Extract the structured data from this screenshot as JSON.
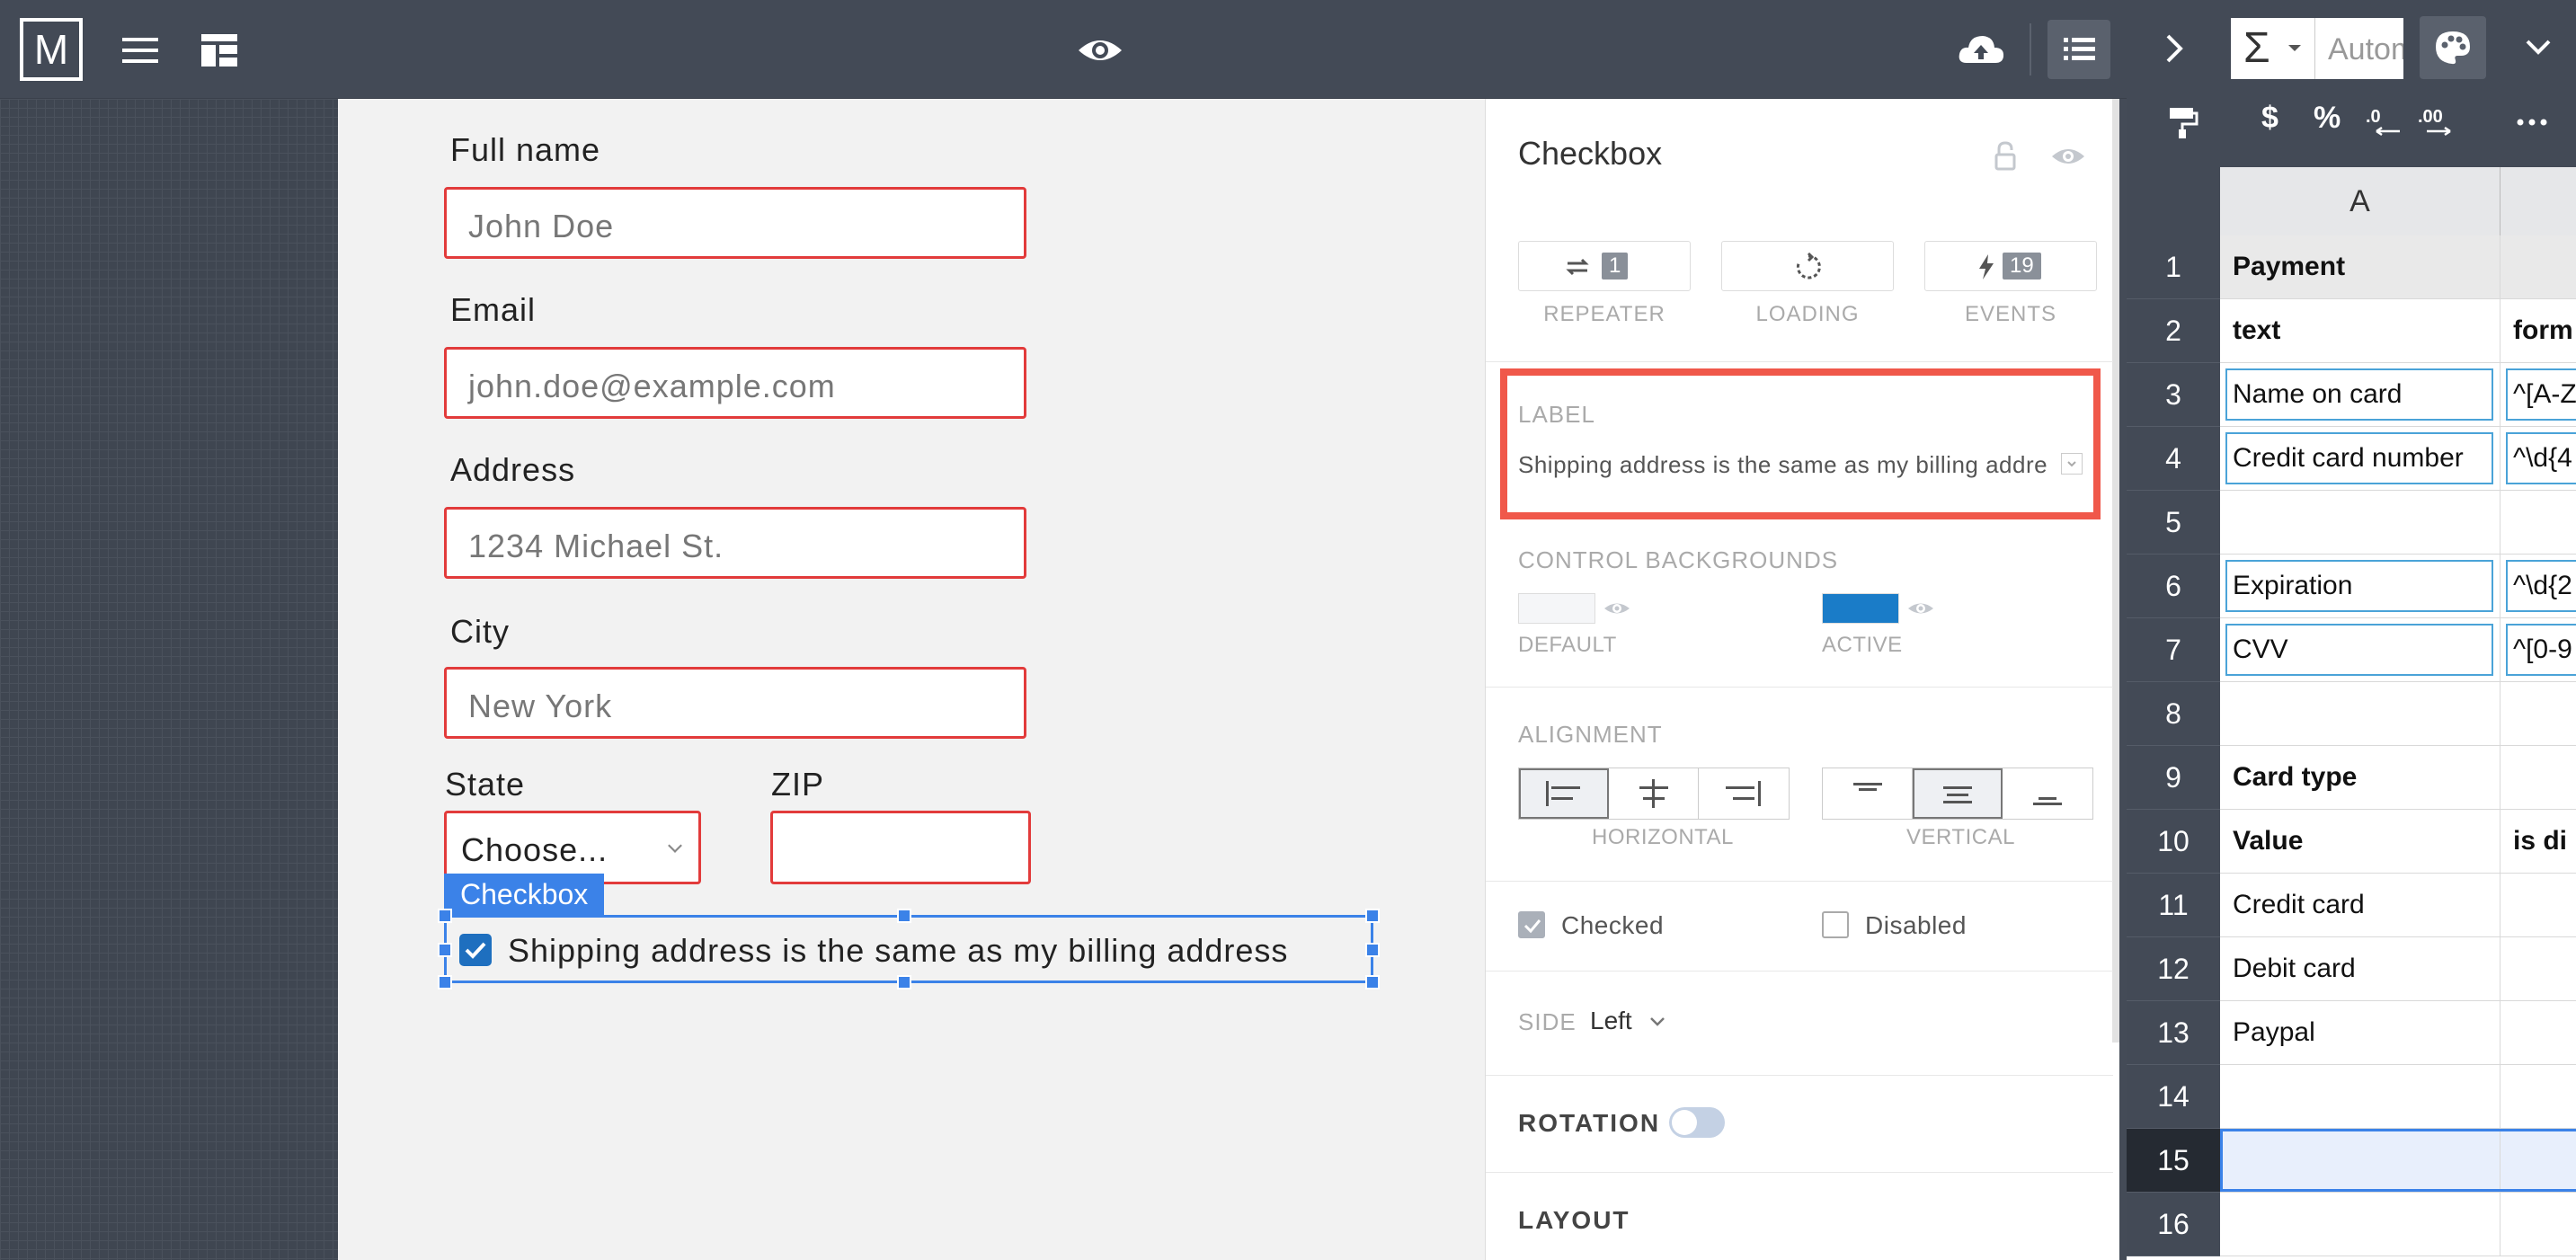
{
  "topbar": {
    "logo": "M"
  },
  "form": {
    "fields": [
      {
        "label": "Full name",
        "placeholder": "John Doe"
      },
      {
        "label": "Email",
        "placeholder": "john.doe@example.com"
      },
      {
        "label": "Address",
        "placeholder": "1234 Michael St."
      },
      {
        "label": "City",
        "placeholder": "New York"
      }
    ],
    "state_label": "State",
    "state_value": "Choose...",
    "zip_label": "ZIP",
    "checkbox_tag": "Checkbox",
    "checkbox_text": "Shipping address is the same as my billing address"
  },
  "inspector": {
    "title": "Checkbox",
    "tabs": [
      {
        "label": "REPEATER",
        "badge": "1"
      },
      {
        "label": "LOADING",
        "badge": ""
      },
      {
        "label": "EVENTS",
        "badge": "19"
      }
    ],
    "label_section": "LABEL",
    "label_value": "Shipping address is the same as my billing address",
    "control_backgrounds": "CONTROL BACKGROUNDS",
    "bg_default": "DEFAULT",
    "bg_active": "ACTIVE",
    "bg_default_color": "#f5f6f8",
    "bg_active_color": "#1a7cc8",
    "alignment": "ALIGNMENT",
    "horizontal": "HORIZONTAL",
    "vertical": "VERTICAL",
    "checked_label": "Checked",
    "disabled_label": "Disabled",
    "side_label": "SIDE",
    "side_value": "Left",
    "rotation_label": "ROTATION",
    "layout_label": "LAYOUT"
  },
  "sheet": {
    "autom": "Autom",
    "column_a": "A",
    "rows": [
      {
        "n": "1",
        "a": "Payment",
        "b": "",
        "style": "gray-bold"
      },
      {
        "n": "2",
        "a": "text",
        "b": "form",
        "style": "bold"
      },
      {
        "n": "3",
        "a": "Name on card",
        "b": "^[A-Z",
        "style": "boxed"
      },
      {
        "n": "4",
        "a": "Credit card number",
        "b": "^\\d{4",
        "style": "boxed"
      },
      {
        "n": "5",
        "a": "",
        "b": "",
        "style": ""
      },
      {
        "n": "6",
        "a": "Expiration",
        "b": "^\\d{2",
        "style": "boxed"
      },
      {
        "n": "7",
        "a": "CVV",
        "b": "^[0-9",
        "style": "boxed"
      },
      {
        "n": "8",
        "a": "",
        "b": "",
        "style": ""
      },
      {
        "n": "9",
        "a": "Card type",
        "b": "",
        "style": "bold"
      },
      {
        "n": "10",
        "a": "Value",
        "b": "is di",
        "style": "bold"
      },
      {
        "n": "11",
        "a": "Credit card",
        "b": "",
        "style": ""
      },
      {
        "n": "12",
        "a": "Debit card",
        "b": "",
        "style": ""
      },
      {
        "n": "13",
        "a": "Paypal",
        "b": "",
        "style": ""
      },
      {
        "n": "14",
        "a": "",
        "b": "",
        "style": ""
      },
      {
        "n": "15",
        "a": "",
        "b": "",
        "style": "selected"
      },
      {
        "n": "16",
        "a": "",
        "b": "",
        "style": ""
      }
    ]
  }
}
